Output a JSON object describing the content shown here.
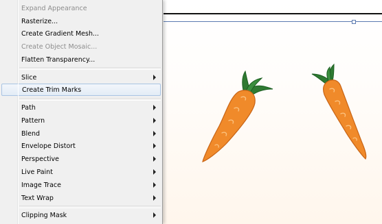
{
  "menu": {
    "items": [
      {
        "label": "Expand Appearance",
        "disabled": true
      },
      {
        "label": "Rasterize...",
        "disabled": false
      },
      {
        "label": "Create Gradient Mesh...",
        "disabled": false
      },
      {
        "label": "Create Object Mosaic...",
        "disabled": true
      },
      {
        "label": "Flatten Transparency...",
        "disabled": false
      },
      {
        "label": "Slice",
        "submenu": true
      },
      {
        "label": "Create Trim Marks",
        "highlighted": true
      },
      {
        "label": "Path",
        "submenu": true
      },
      {
        "label": "Pattern",
        "submenu": true
      },
      {
        "label": "Blend",
        "submenu": true
      },
      {
        "label": "Envelope Distort",
        "submenu": true
      },
      {
        "label": "Perspective",
        "submenu": true
      },
      {
        "label": "Live Paint",
        "submenu": true
      },
      {
        "label": "Image Trace",
        "submenu": true
      },
      {
        "label": "Text Wrap",
        "submenu": true
      },
      {
        "label": "Clipping Mask",
        "submenu": true
      }
    ]
  },
  "canvas": {
    "objects": [
      "carrot-icon",
      "carrot-icon"
    ]
  },
  "colors": {
    "menu_bg": "#f0f0f0",
    "highlight_border": "#a8c3e3",
    "disabled_text": "#8d8d8d",
    "carrot_orange": "#f08a2a",
    "carrot_leaf": "#2e7d32",
    "selection_blue": "#5b79b0"
  }
}
